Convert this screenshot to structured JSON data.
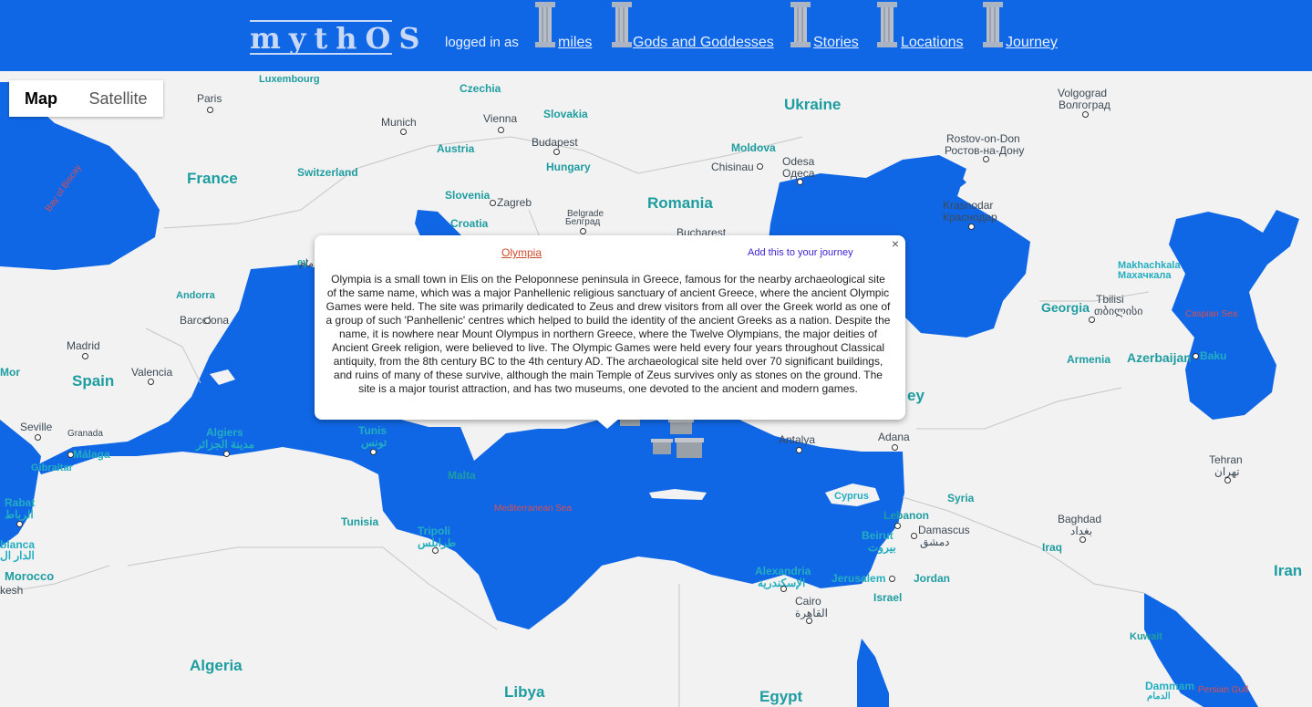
{
  "header": {
    "logo": "mythOS",
    "logged_in_prefix": "logged in as",
    "username": "miles",
    "nav": [
      "Gods and Goddesses",
      "Stories",
      "Locations",
      "Journey"
    ]
  },
  "map_controls": {
    "map_label": "Map",
    "satellite_label": "Satellite"
  },
  "popup": {
    "title": "Olympia",
    "add_label": "Add this to your journey",
    "close_symbol": "×",
    "body": "Olympia is a small town in Elis on the Peloponnese peninsula in Greece, famous for the nearby archaeological site of the same name, which was a major Panhellenic religious sanctuary of ancient Greece, where the ancient Olympic Games were held. The site was primarily dedicated to Zeus and drew visitors from all over the Greek world as one of a group of such 'Panhellenic' centres which helped to build the identity of the ancient Greeks as a nation. Despite the name, it is nowhere near Mount Olympus in northern Greece, where the Twelve Olympians, the major deities of Ancient Greek religion, were believed to live. The Olympic Games were held every four years throughout Classical antiquity, from the 8th century BC to the 4th century AD. The archaeological site held over 70 significant buildings, and ruins of many of these survive, although the main Temple of Zeus survives only as stones on the ground. The site is a major tourist attraction, and has two museums, one devoted to the ancient and modern games."
  },
  "map_labels": {
    "countries": [
      "France",
      "Spain",
      "Algeria",
      "Libya",
      "Egypt",
      "Romania",
      "Ukraine",
      "Iran",
      "Iraq",
      "Syria",
      "Georgia",
      "Armenia",
      "Azerbaijan",
      "Morocco",
      "Switzerland",
      "Austria",
      "Hungary",
      "Slovakia",
      "Czechia",
      "Slovenia",
      "Croatia",
      "Moldova",
      "Jordan",
      "Israel",
      "Lebanon",
      "Tunisia",
      "Malta",
      "Cyprus",
      "Kuwait",
      "Andorra",
      "Luxembourg",
      "ey"
    ],
    "cities": [
      "Paris",
      "Munich",
      "Vienna",
      "Budapest",
      "Zagreb",
      "Belgrade",
      "Белград",
      "Bucharest",
      "Chisinau",
      "Odesa",
      "Одеса",
      "Volgograd",
      "Волгоград",
      "Rostov-on-Don",
      "Ростов-на-Дону",
      "Krasnodar",
      "Краснодар",
      "Makhachkala",
      "Махачкала",
      "Tbilisi",
      "თბილისი",
      "Baku",
      "Madrid",
      "Barcelona",
      "Valencia",
      "Seville",
      "Granada",
      "Málaga",
      "Gibraltar",
      "Rabat",
      "الرباط",
      "blanca",
      "الدار ال",
      "kesh",
      "Algiers",
      "مدينة الجزائر",
      "Tunis",
      "تونس",
      "Tripoli",
      "طرابلس",
      "Antalya",
      "Adana",
      "Beirut",
      "بيروت",
      "Damascus",
      "دمشق",
      "Jerusalem",
      "Alexandria",
      "الإسكندرية",
      "Cairo",
      "القاهرة",
      "Baghdad",
      "بغداد",
      "Tehran",
      "تهران",
      "Dammam",
      "الدمام",
      "Mor",
      "al"
    ],
    "seas": [
      "Bay of Biscay",
      "Mediterranean Sea",
      "Caspian Sea",
      "Persian Gulf"
    ]
  },
  "colors": {
    "header": "#1067e6",
    "water": "#1067e6",
    "land": "#f2f2f2",
    "link_red": "#d04a2d",
    "link_purple": "#3b1ed0"
  },
  "icons": [
    "column-icon",
    "temple-icon",
    "close-icon"
  ]
}
